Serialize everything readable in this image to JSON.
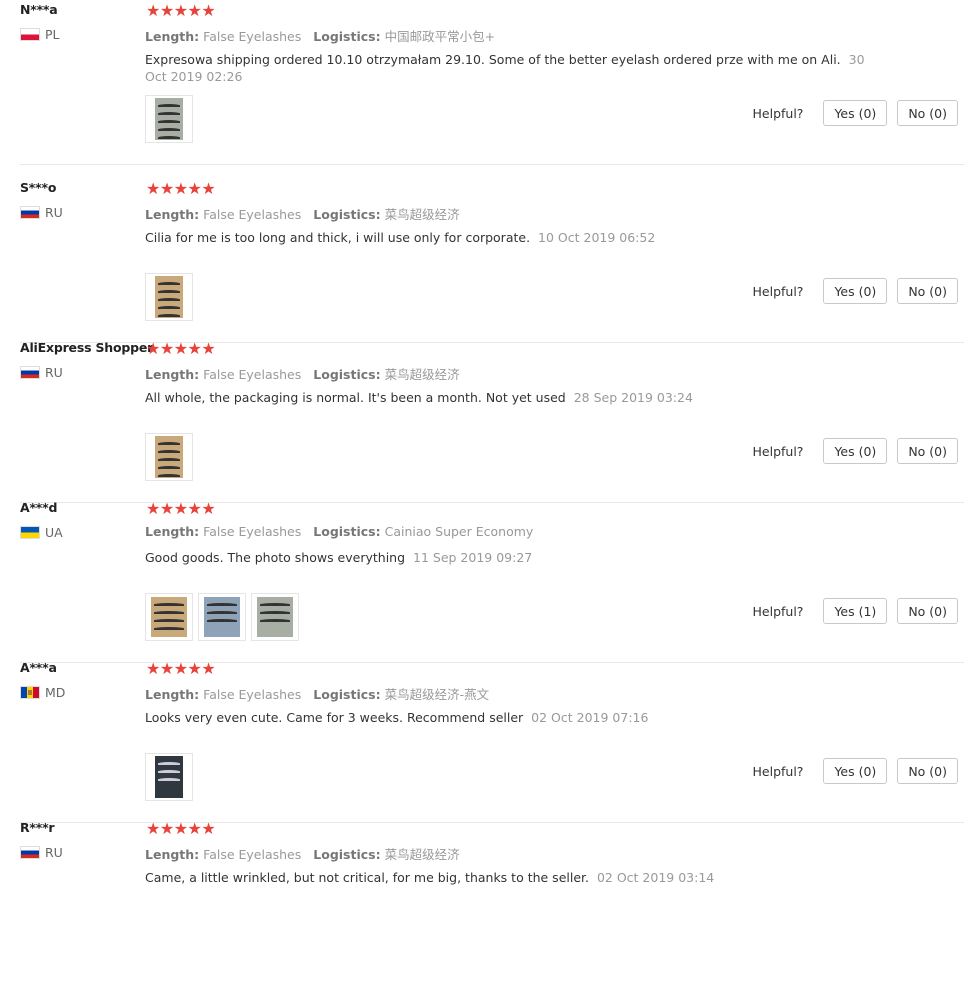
{
  "star_icon": "★",
  "labels": {
    "length": "Length:",
    "logistics": "Logistics:",
    "helpful": "Helpful?"
  },
  "reviews": [
    {
      "user": "N***a",
      "country": "PL",
      "flag": "pl",
      "stars": 5,
      "length": "False Eyelashes",
      "logistics": "中国邮政平常小包+",
      "text": "Expresowa shipping ordered 10.10 otrzymałam 29.10. Some of the better eyelash ordered prze with me on Ali.",
      "date": "30 Oct 2019 02:26",
      "photos": 1,
      "yes": "Yes (0)",
      "no": "No (0)"
    },
    {
      "user": "S***o",
      "country": "RU",
      "flag": "ru",
      "stars": 5,
      "length": "False Eyelashes",
      "logistics": "菜鸟超级经济",
      "text": "Cilia for me is too long and thick, i will use only for corporate.",
      "date": "10 Oct 2019 06:52",
      "photos": 1,
      "yes": "Yes (0)",
      "no": "No (0)"
    },
    {
      "user": "AliExpress Shopper",
      "country": "RU",
      "flag": "ru",
      "stars": 5,
      "length": "False Eyelashes",
      "logistics": "菜鸟超级经济",
      "text": "All whole, the packaging is normal. It's been a month. Not yet used",
      "date": "28 Sep 2019 03:24",
      "photos": 1,
      "yes": "Yes (0)",
      "no": "No (0)"
    },
    {
      "user": "A***d",
      "country": "UA",
      "flag": "ua",
      "stars": 5,
      "length": "False Eyelashes",
      "logistics": "Cainiao Super Economy",
      "text": "Good goods. The photo shows everything",
      "date": "11 Sep 2019 09:27",
      "photos": 3,
      "yes": "Yes (1)",
      "no": "No (0)"
    },
    {
      "user": "A***a",
      "country": "MD",
      "flag": "md",
      "stars": 5,
      "length": "False Eyelashes",
      "logistics": "菜鸟超级经济-燕文",
      "text": "Looks very even cute. Came for 3 weeks. Recommend seller",
      "date": "02 Oct 2019 07:16",
      "photos": 1,
      "yes": "Yes (0)",
      "no": "No (0)"
    },
    {
      "user": "R***r",
      "country": "RU",
      "flag": "ru",
      "stars": 5,
      "length": "False Eyelashes",
      "logistics": "菜鸟超级经济",
      "text": "Came, a little wrinkled, but not critical, for me big, thanks to the seller.",
      "date": "02 Oct 2019 03:14",
      "photos": 0,
      "yes": "",
      "no": ""
    }
  ]
}
